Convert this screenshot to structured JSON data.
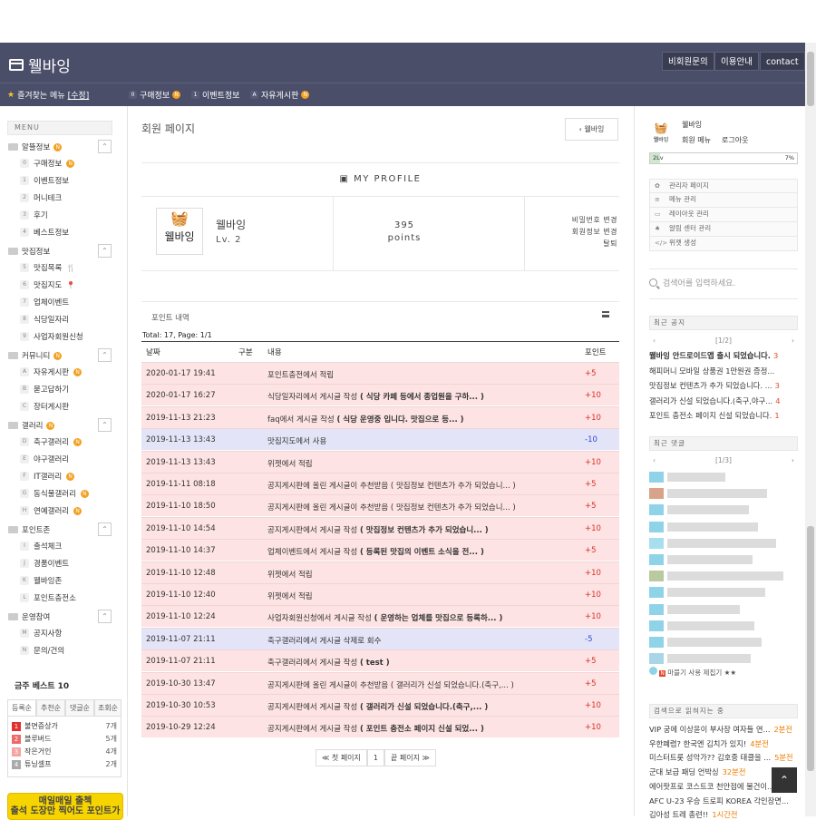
{
  "header": {
    "logo": "웰바잉",
    "buttons": [
      "비회원문의",
      "이용안내",
      "contact"
    ]
  },
  "favbar": {
    "title": "즐겨찾는 메뉴",
    "edit": "[수정]",
    "items": [
      {
        "key": "0",
        "label": "구매정보",
        "new": true
      },
      {
        "key": "1",
        "label": "이벤트정보",
        "new": false
      },
      {
        "key": "A",
        "label": "자유게시판",
        "new": true
      }
    ]
  },
  "sidebar": {
    "menu_label": "MENU",
    "categories": [
      {
        "label": "알뜰정보",
        "new": true,
        "items": [
          {
            "k": "0",
            "t": "구매정보",
            "n": true
          },
          {
            "k": "1",
            "t": "이벤트정보"
          },
          {
            "k": "2",
            "t": "머니테크"
          },
          {
            "k": "3",
            "t": "후기"
          },
          {
            "k": "4",
            "t": "베스트정보"
          }
        ]
      },
      {
        "label": "맛집정보",
        "items": [
          {
            "k": "5",
            "t": "맛집목록",
            "icon": "fork-knife-icon"
          },
          {
            "k": "6",
            "t": "맛집지도",
            "icon": "map-pin-icon"
          },
          {
            "k": "7",
            "t": "업체이벤트"
          },
          {
            "k": "8",
            "t": "식당일자리"
          },
          {
            "k": "9",
            "t": "사업자회원신청"
          }
        ]
      },
      {
        "label": "커뮤니티",
        "new": true,
        "items": [
          {
            "k": "A",
            "t": "자유게시판",
            "n": true
          },
          {
            "k": "B",
            "t": "묻고답하기"
          },
          {
            "k": "C",
            "t": "장터게시판"
          }
        ]
      },
      {
        "label": "갤러리",
        "new": true,
        "items": [
          {
            "k": "D",
            "t": "축구갤러리",
            "n": true
          },
          {
            "k": "E",
            "t": "야구갤러리"
          },
          {
            "k": "F",
            "t": "IT갤러리",
            "n": true
          },
          {
            "k": "G",
            "t": "동식물갤러리",
            "n": true
          },
          {
            "k": "H",
            "t": "연예갤러리",
            "n": true
          }
        ]
      },
      {
        "label": "포인트존",
        "items": [
          {
            "k": "I",
            "t": "출석체크"
          },
          {
            "k": "J",
            "t": "경품이벤트"
          },
          {
            "k": "K",
            "t": "웰바잉존"
          },
          {
            "k": "L",
            "t": "포인트충전소"
          }
        ]
      },
      {
        "label": "운영참여",
        "items": [
          {
            "k": "M",
            "t": "공지사항"
          },
          {
            "k": "N",
            "t": "문의/건의"
          }
        ]
      }
    ],
    "weekly_title": "금주 베스트 10",
    "weekly_tabs": [
      "등록순",
      "추천순",
      "댓글순",
      "조회순"
    ],
    "weekly_items": [
      {
        "rank": "1",
        "title": "불면증상가",
        "count": "7개",
        "color": "#e03030"
      },
      {
        "rank": "2",
        "title": "블루버드",
        "count": "5개",
        "color": "#ee6a6a"
      },
      {
        "rank": "3",
        "title": "작은거인",
        "count": "4개",
        "color": "#f4a4a4"
      },
      {
        "rank": "4",
        "title": "튜닝셀프",
        "count": "2개",
        "color": "#aaaaaa"
      }
    ],
    "banner_title": "매일매일 출첵",
    "banner_sub": "출석 도장만 찍어도 포인트가"
  },
  "main": {
    "page_title": "회원 페이지",
    "back_btn": "웰바잉",
    "profile_header": "MY PROFILE",
    "user_name": "웰바잉",
    "level": "Lv. 2",
    "avatar_text": "웰바잉",
    "points_value": "395",
    "points_unit": "points",
    "links": [
      "비밀번호 변경",
      "회원정보 변경",
      "탈퇴"
    ],
    "points_title": "포인트 내역",
    "total": "Total: 17, Page: 1/1",
    "columns": [
      "날짜",
      "구분",
      "내용",
      "포인트"
    ],
    "rows": [
      {
        "date": "2020-01-17 19:41",
        "content": "포인트충전에서 적립",
        "bold": "",
        "point": "+5",
        "type": "pk"
      },
      {
        "date": "2020-01-17 16:27",
        "content": "식당일자리에서 게시글 작성 ",
        "bold": "( 식당 카페 등에서 종업원을 구하... )",
        "point": "+10",
        "type": "pk"
      },
      {
        "date": "2019-11-13 21:23",
        "content": "faq에서 게시글 작성 ",
        "bold": "( 식당 운영중 입니다. 맛집으로 등... )",
        "point": "+10",
        "type": "pk"
      },
      {
        "date": "2019-11-13 13:43",
        "content": "맛집지도에서 사용",
        "bold": "",
        "point": "-10",
        "type": "bl"
      },
      {
        "date": "2019-11-13 13:43",
        "content": "위젯에서 적립",
        "bold": "",
        "point": "+10",
        "type": "pk"
      },
      {
        "date": "2019-11-11 08:18",
        "content": "공지게시판에 올린 게시글이 추천받음 ( 맛집정보 컨텐츠가 추가 되었습니... )",
        "bold": "",
        "point": "+5",
        "type": "pk"
      },
      {
        "date": "2019-11-10 18:50",
        "content": "공지게시판에 올린 게시글이 추천받음 ( 맛집정보 컨텐츠가 추가 되었습니... )",
        "bold": "",
        "point": "+5",
        "type": "pk"
      },
      {
        "date": "2019-11-10 14:54",
        "content": "공지게시판에서 게시글 작성 ",
        "bold": "( 맛집정보 컨텐츠가 추가 되었습니... )",
        "point": "+10",
        "type": "pk"
      },
      {
        "date": "2019-11-10 14:37",
        "content": "업체이벤트에서 게시글 작성 ",
        "bold": "( 등록된 맛집의 이벤트 소식을 전... )",
        "point": "+5",
        "type": "pk"
      },
      {
        "date": "2019-11-10 12:48",
        "content": "위젯에서 적립",
        "bold": "",
        "point": "+10",
        "type": "pk"
      },
      {
        "date": "2019-11-10 12:40",
        "content": "위젯에서 적립",
        "bold": "",
        "point": "+10",
        "type": "pk"
      },
      {
        "date": "2019-11-10 12:24",
        "content": "사업자회원신청에서 게시글 작성 ",
        "bold": "( 운영하는 업체를 맛집으로 등록하... )",
        "point": "+10",
        "type": "pk"
      },
      {
        "date": "2019-11-07 21:11",
        "content": "축구갤러리에서 게시글 삭제로 회수",
        "bold": "",
        "point": "-5",
        "type": "bl"
      },
      {
        "date": "2019-11-07 21:11",
        "content": "축구갤러리에서 게시글 작성 ",
        "bold": "( test )",
        "point": "+5",
        "type": "pk"
      },
      {
        "date": "2019-10-30 13:47",
        "content": "공지게시판에 올린 게시글이 추천받음 ( 갤러리가 신설 되었습니다.(축구,... )",
        "bold": "",
        "point": "+5",
        "type": "pk"
      },
      {
        "date": "2019-10-30 10:53",
        "content": "공지게시판에서 게시글 작성 ",
        "bold": "( 갤러리가 신설 되었습니다.(축구,... )",
        "point": "+10",
        "type": "pk"
      },
      {
        "date": "2019-10-29 12:24",
        "content": "공지게시판에서 게시글 작성 ",
        "bold": "( 포인트 충전소 페이지 신설 되었... )",
        "point": "+10",
        "type": "pk"
      }
    ],
    "pager": {
      "first": "≪ 첫 페이지",
      "current": "1",
      "last": "끝 페이지 ≫"
    }
  },
  "right": {
    "avatar_text": "웰바잉",
    "name": "웰바잉",
    "links": [
      "회원 메뉴",
      "로그아웃"
    ],
    "level_label": "2Lv",
    "level_pct": "7%",
    "level_fraction": 0.07,
    "admin": [
      {
        "icon": "gear-icon",
        "label": "관리자 페이지",
        "g": "✿"
      },
      {
        "icon": "menu-icon",
        "label": "메뉴 관리",
        "g": "≡"
      },
      {
        "icon": "layout-icon",
        "label": "레이아웃 관리",
        "g": "▭"
      },
      {
        "icon": "bell-icon",
        "label": "알림 센터 관리",
        "g": "♠"
      },
      {
        "icon": "code-icon",
        "label": "위젯 생성",
        "g": "</>"
      }
    ],
    "search_placeholder": "검색어를 입력하세요.",
    "notice_title": "최근 공지",
    "notice_page": "[1/2]",
    "notices": [
      {
        "t": "웰바잉 안드로이드앱 출시 되었습니다.",
        "c": "3",
        "bold": true
      },
      {
        "t": "해피머니 모바일 상품권 1만원권 증정...",
        "c": ""
      },
      {
        "t": "맛집정보 컨텐츠가 추가 되었습니다. ...",
        "c": "3"
      },
      {
        "t": "갤러리가 신설 되었습니다.(축구,야구...",
        "c": "4"
      },
      {
        "t": "포인트 충전소 페이지 신설 되었습니다.",
        "c": "1"
      }
    ],
    "comment_title": "최근 댓글",
    "comment_page": "[1/3]",
    "comment_last": "마블기 사용 제집기 ★★",
    "keywords_title": "검색으로 읽혀지는 중",
    "keywords": [
      {
        "t": "VIP 궁에 이상윤이 부사장 여자들 연...",
        "m": "2분전"
      },
      {
        "t": "우한폐렴? 한국엔 김치가 있지!",
        "m": "4분전"
      },
      {
        "t": "미스터트롯 성악가?? 김호중 태클을 ...",
        "m": "5분전"
      },
      {
        "t": "군대 보급 패딩 언박싱",
        "m": "32분전"
      },
      {
        "t": "에어팟프로 코스트코 천안점에 물건이...",
        "m": ""
      },
      {
        "t": "AFC U-23 우승 트로피 KOREA 각인장면...",
        "m": ""
      },
      {
        "t": "김아성 트레 총련!!",
        "m": "1시간전"
      }
    ]
  }
}
